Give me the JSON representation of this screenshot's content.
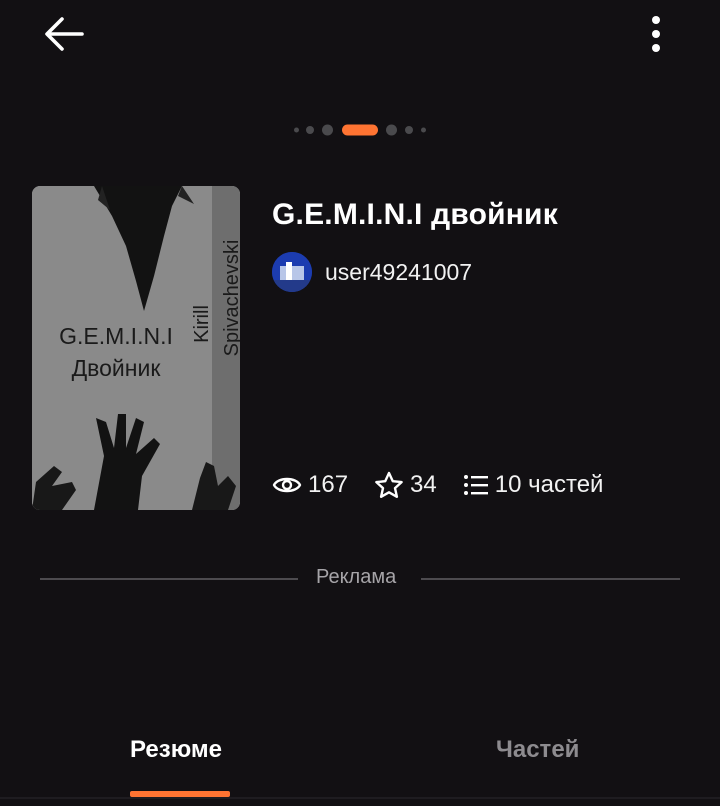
{
  "header": {
    "back_icon": "arrow-left-icon",
    "menu_icon": "more-vertical-icon"
  },
  "carousel": {
    "dot_count": 7,
    "active_index": 3,
    "active_color": "#ff7432"
  },
  "story": {
    "title": "G.E.M.I.N.I двойник",
    "cover": {
      "title_line1": "G.E.M.I.N.I",
      "title_line2": "Двойник",
      "author_first": "Kirill",
      "author_last": "Spivachevski"
    },
    "author": "user49241007",
    "stats": {
      "views": "167",
      "votes": "34",
      "parts": "10 частей"
    }
  },
  "ad": {
    "label": "Реклама"
  },
  "tabs": [
    {
      "label": "Резюме",
      "active": true
    },
    {
      "label": "Частей",
      "active": false
    }
  ],
  "colors": {
    "background": "#121013",
    "accent": "#ff7432"
  }
}
